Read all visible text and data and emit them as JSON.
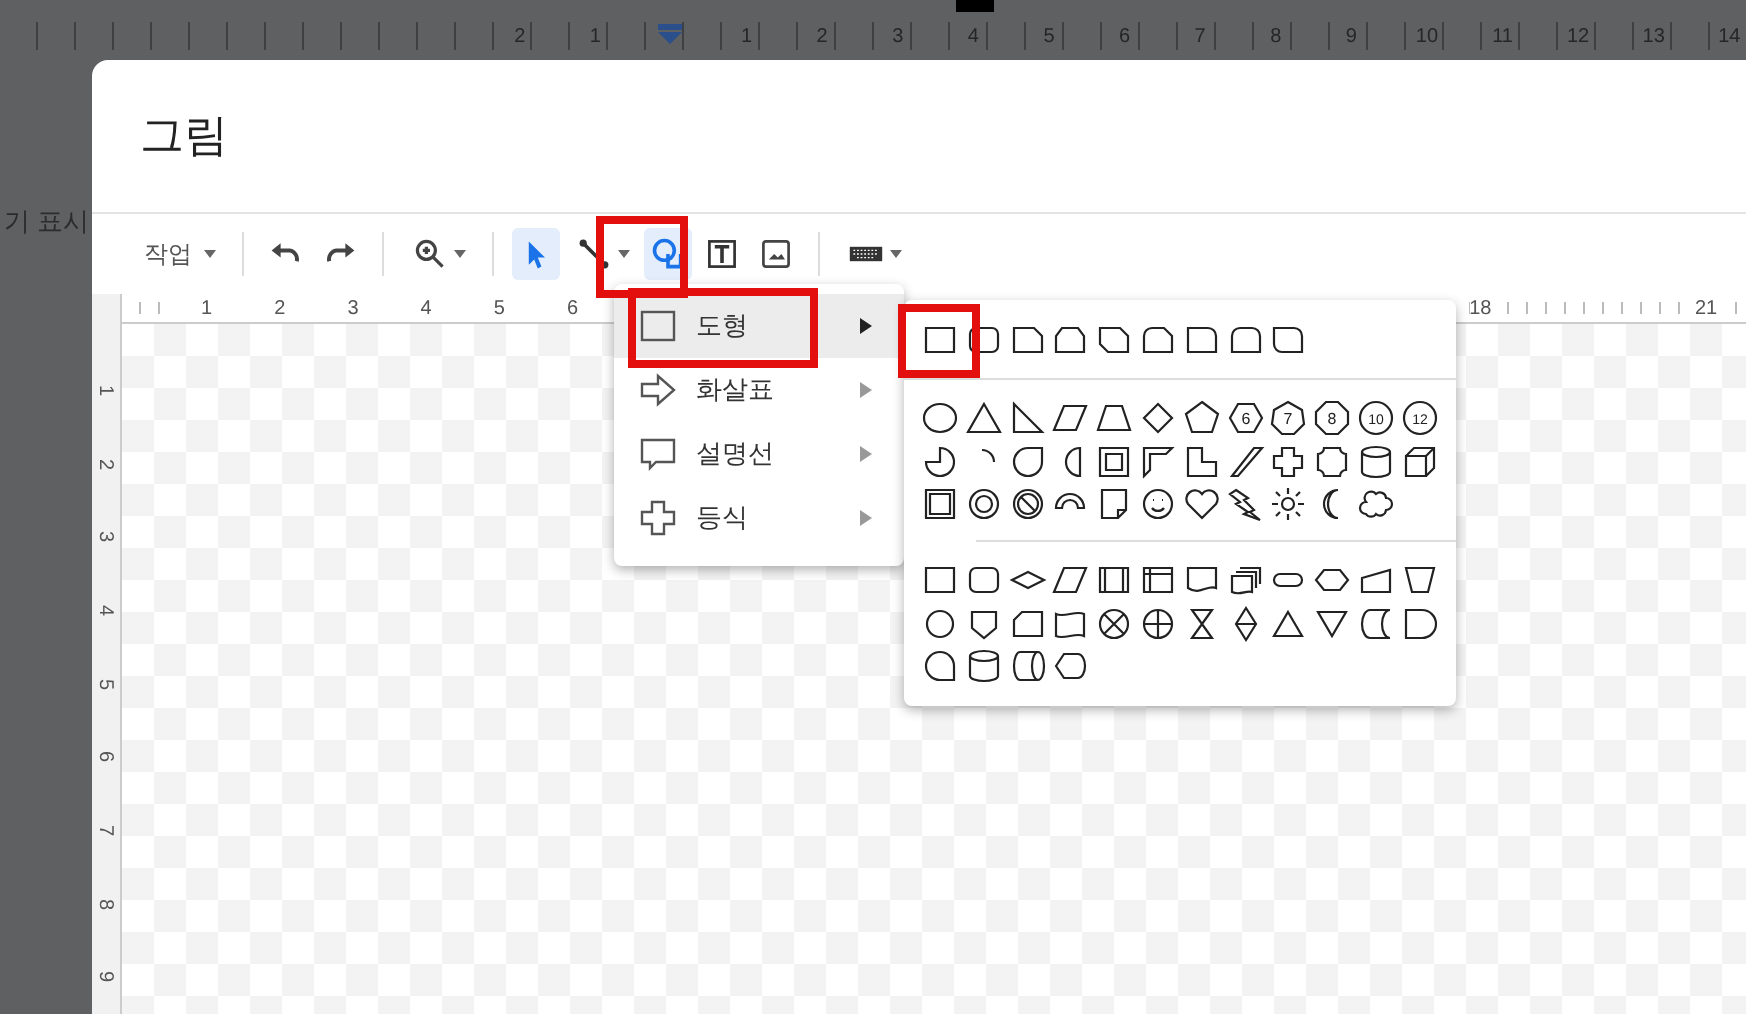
{
  "doc_ruler": {
    "left_numbers": [
      "2",
      "1"
    ],
    "right_numbers": [
      "1",
      "2",
      "3",
      "4",
      "5",
      "6",
      "7",
      "8",
      "9",
      "10",
      "11",
      "12",
      "13",
      "14"
    ]
  },
  "doc_text_fragment": "기 표시",
  "dialog": {
    "title": "그림",
    "toolbar": {
      "actions_menu": "작업",
      "tools": [
        {
          "kind": "select",
          "selected": true,
          "menu": false
        },
        {
          "kind": "line",
          "selected": false,
          "menu": true
        },
        {
          "kind": "shape",
          "selected": true,
          "menu": false
        },
        {
          "kind": "textbox",
          "selected": false,
          "menu": false
        },
        {
          "kind": "image",
          "selected": false,
          "menu": false
        }
      ]
    },
    "ruler": {
      "left_numbers": [
        "1",
        "2",
        "3",
        "4",
        "5",
        "6"
      ],
      "right_numbers": [
        "18",
        "21"
      ]
    },
    "vertical_ruler": [
      "1",
      "2",
      "3",
      "4",
      "5",
      "6",
      "7",
      "8",
      "9"
    ]
  },
  "shape_menu": {
    "items": [
      {
        "kind": "shape",
        "label": "도형",
        "selected": true
      },
      {
        "kind": "arrow",
        "label": "화살표",
        "selected": false
      },
      {
        "kind": "callout",
        "label": "설명선",
        "selected": false
      },
      {
        "kind": "equation",
        "label": "등식",
        "selected": false
      }
    ]
  },
  "polygon_labels": [
    "6",
    "7",
    "8",
    "10",
    "12"
  ]
}
